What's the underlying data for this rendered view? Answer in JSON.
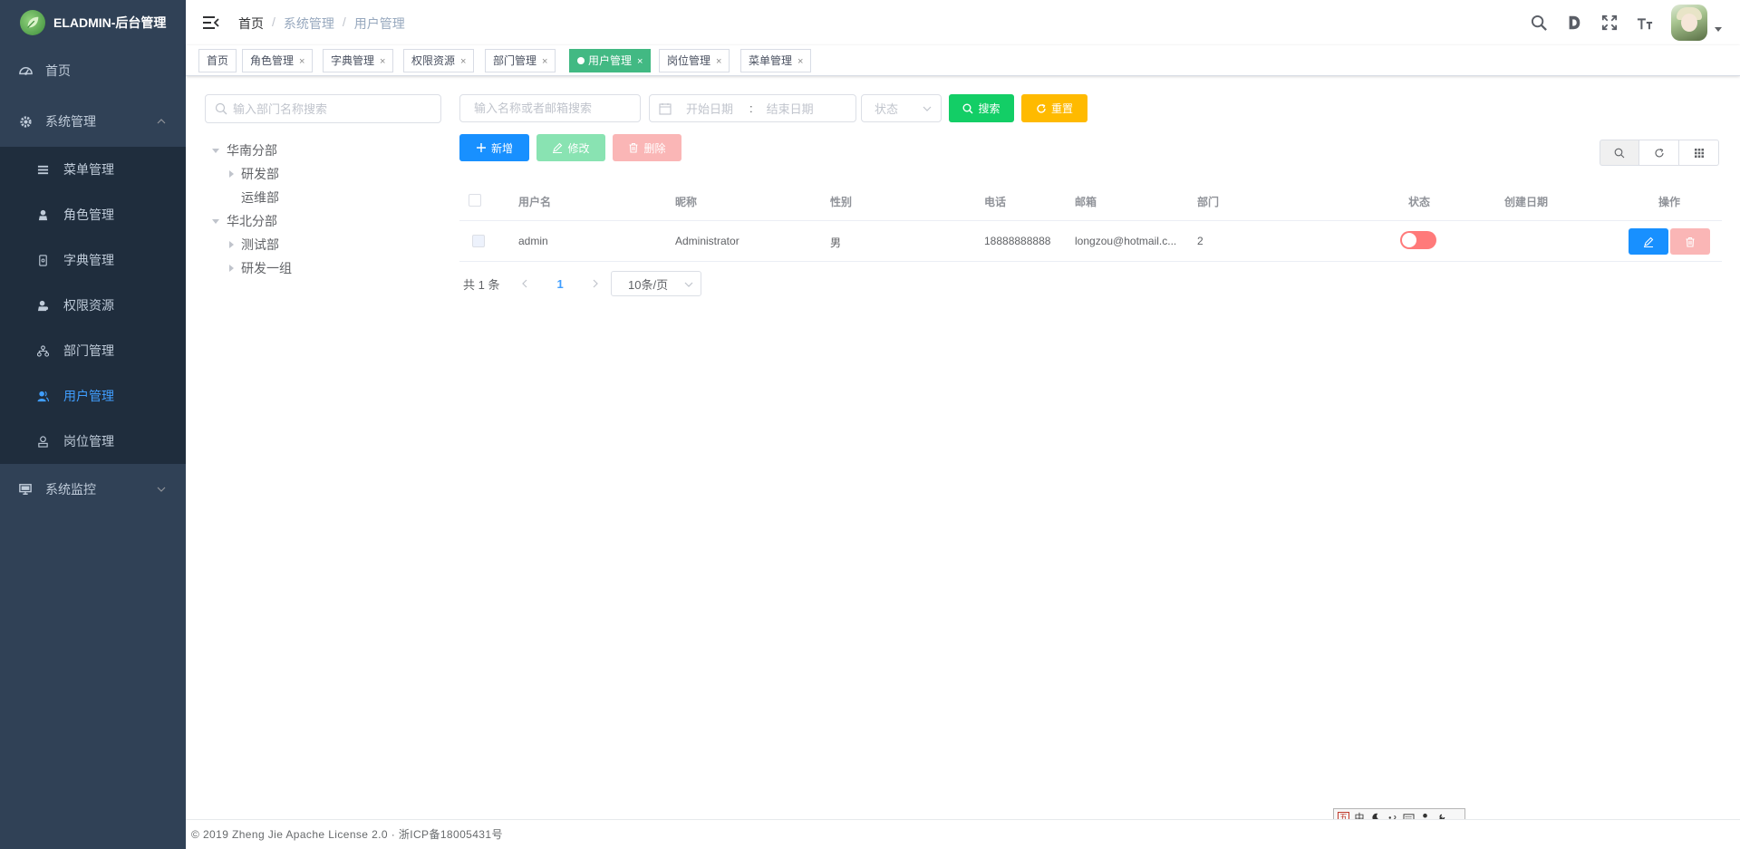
{
  "app": {
    "title": "ELADMIN-后台管理"
  },
  "sidebar": {
    "items": [
      {
        "label": "首页",
        "icon": "dashboard-icon"
      },
      {
        "label": "系统管理",
        "icon": "gear-icon",
        "expanded": true,
        "children": [
          {
            "label": "菜单管理",
            "icon": "menu-icon"
          },
          {
            "label": "角色管理",
            "icon": "role-icon"
          },
          {
            "label": "字典管理",
            "icon": "dictionary-icon"
          },
          {
            "label": "权限资源",
            "icon": "permission-icon"
          },
          {
            "label": "部门管理",
            "icon": "department-icon"
          },
          {
            "label": "用户管理",
            "icon": "user-icon",
            "active": true
          },
          {
            "label": "岗位管理",
            "icon": "post-icon"
          }
        ]
      },
      {
        "label": "系统监控",
        "icon": "monitor-icon",
        "expanded": false
      }
    ],
    "colors": {
      "bg": "#304156",
      "submenu_bg": "#1f2d3d",
      "text": "#bfcbd9",
      "active": "#409eff"
    }
  },
  "navbar": {
    "breadcrumb": [
      "首页",
      "系统管理",
      "用户管理"
    ]
  },
  "tags": [
    {
      "label": "首页",
      "closable": false
    },
    {
      "label": "角色管理",
      "closable": true
    },
    {
      "label": "字典管理",
      "closable": true
    },
    {
      "label": "权限资源",
      "closable": true
    },
    {
      "label": "部门管理",
      "closable": true
    },
    {
      "label": "用户管理",
      "closable": true,
      "active": true
    },
    {
      "label": "岗位管理",
      "closable": true
    },
    {
      "label": "菜单管理",
      "closable": true
    }
  ],
  "dept_panel": {
    "search_placeholder": "输入部门名称搜索",
    "tree": [
      {
        "label": "华南分部",
        "expanded": true,
        "children": [
          {
            "label": "研发部",
            "has_children": true
          },
          {
            "label": "运维部",
            "has_children": false
          }
        ]
      },
      {
        "label": "华北分部",
        "expanded": true,
        "children": [
          {
            "label": "测试部",
            "has_children": true
          },
          {
            "label": "研发一组",
            "has_children": true
          }
        ]
      }
    ]
  },
  "filters": {
    "keyword_placeholder": "输入名称或者邮箱搜索",
    "start_date_placeholder": "开始日期",
    "date_separator": ":",
    "end_date_placeholder": "结束日期",
    "status_placeholder": "状态",
    "search_label": "搜索",
    "reset_label": "重置"
  },
  "toolbar": {
    "add_label": "新增",
    "edit_label": "修改",
    "delete_label": "删除"
  },
  "table": {
    "columns": [
      "用户名",
      "昵称",
      "性别",
      "电话",
      "邮箱",
      "部门",
      "状态",
      "创建日期",
      "操作"
    ],
    "rows": [
      {
        "username": "admin",
        "nickname": "Administrator",
        "gender": "男",
        "phone": "18888888888",
        "email": "longzou@hotmail.c...",
        "dept": "2",
        "enabled": false,
        "created": ""
      }
    ]
  },
  "pagination": {
    "total_text": "共 1 条",
    "current_page": "1",
    "page_size": "10条/页"
  },
  "footer": {
    "text": "© 2019 Zheng Jie Apache License 2.0 · 浙ICP备18005431号"
  },
  "ime": {
    "logo": "五",
    "mode": "中"
  }
}
